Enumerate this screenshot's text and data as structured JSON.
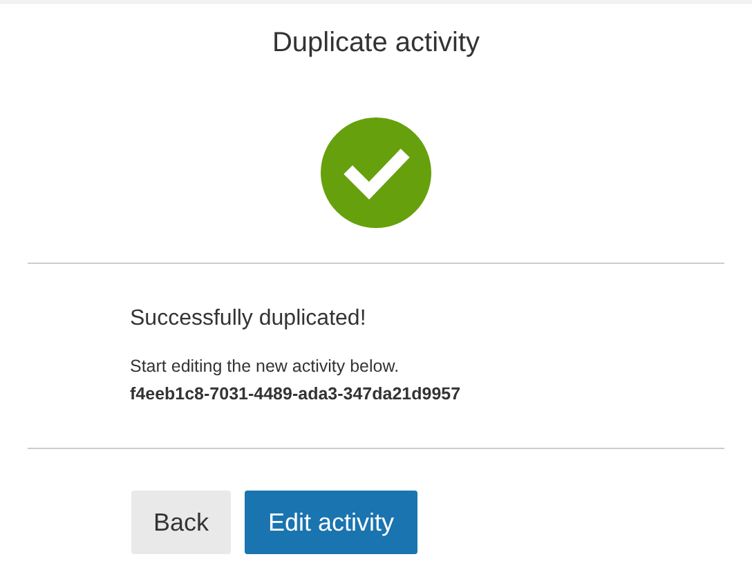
{
  "dialog": {
    "title": "Duplicate activity"
  },
  "message": {
    "heading": "Successfully duplicated!",
    "text": "Start editing the new activity below.",
    "id": "f4eeb1c8-7031-4489-ada3-347da21d9957"
  },
  "buttons": [
    {
      "label": "Back",
      "kind": "secondary"
    },
    {
      "label": "Edit activity",
      "kind": "primary"
    }
  ]
}
